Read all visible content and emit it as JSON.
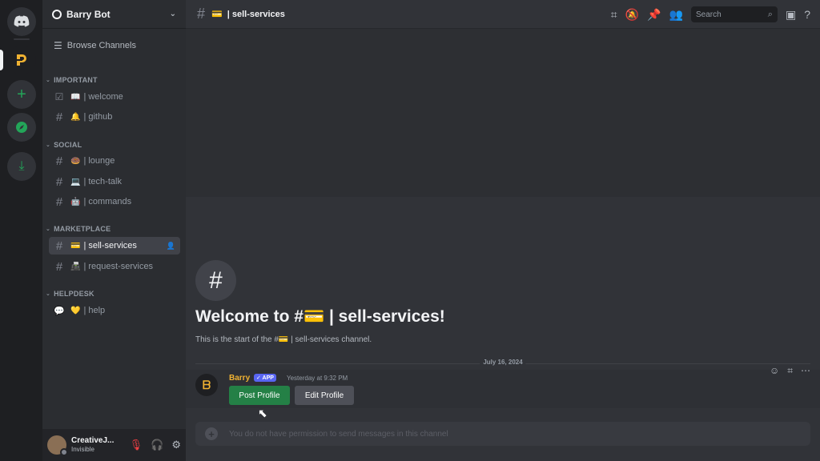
{
  "guild": {
    "name": "Barry Bot"
  },
  "sidebar": {
    "browse": "Browse Channels",
    "categories": [
      {
        "name": "IMPORTANT",
        "channels": [
          {
            "emoji": "📖",
            "name": "| welcome"
          },
          {
            "emoji": "🔔",
            "name": "| github"
          }
        ]
      },
      {
        "name": "SOCIAL",
        "channels": [
          {
            "emoji": "🍩",
            "name": "| lounge"
          },
          {
            "emoji": "💻",
            "name": "| tech-talk"
          },
          {
            "emoji": "🤖",
            "name": "| commands"
          }
        ]
      },
      {
        "name": "MARKETPLACE",
        "channels": [
          {
            "emoji": "💳",
            "name": "| sell-services"
          },
          {
            "emoji": "📠",
            "name": "| request-services"
          }
        ]
      },
      {
        "name": "HELPDESK",
        "channels": [
          {
            "emoji": "💛",
            "name": "| help"
          }
        ]
      }
    ]
  },
  "user": {
    "name": "CreativeJ...",
    "status": "Invisible"
  },
  "header": {
    "emoji": "💳",
    "title": "| sell-services",
    "search_placeholder": "Search"
  },
  "welcome": {
    "heading": "Welcome to #💳 | sell-services!",
    "text": "This is the start of the #💳 | sell-services channel."
  },
  "divider_date": "July 16, 2024",
  "message": {
    "author": "Barry",
    "tag": "✓ APP",
    "timestamp": "Yesterday at 9:32 PM",
    "buttons": [
      "Post Profile",
      "Edit Profile"
    ]
  },
  "composer": {
    "placeholder": "You do not have permission to send messages in this channel"
  },
  "colors": {
    "accent": "#5865f2",
    "success": "#248046",
    "bot_name": "#f0b232"
  }
}
